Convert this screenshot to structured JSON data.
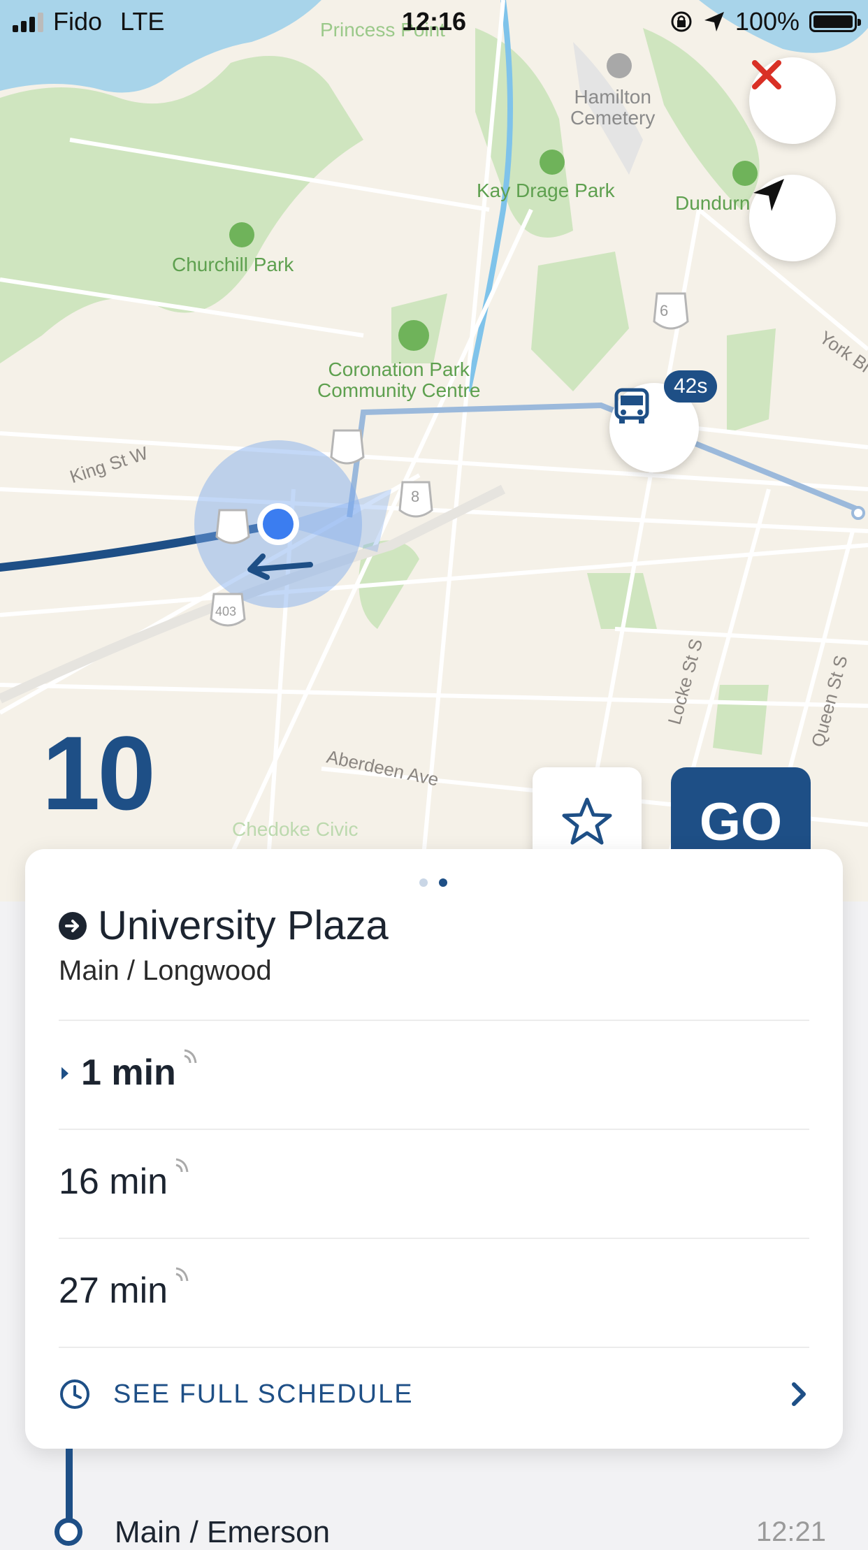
{
  "status_bar": {
    "carrier": "Fido",
    "network": "LTE",
    "time": "12:16",
    "battery": "100%"
  },
  "map": {
    "labels": {
      "princess_point": "Princess Point",
      "hamilton_cemetery": "Hamilton\nCemetery",
      "kay_drage_park": "Kay Drage Park",
      "dundurn": "Dundurn",
      "churchill_park": "Churchill Park",
      "coronation_park": "Coronation Park\nCommunity Centre",
      "king_st_w": "King St W",
      "york_blvd": "York Bl",
      "locke_st_s": "Locke St S",
      "queen_st_s": "Queen St S",
      "aberdeen_ave": "Aberdeen Ave",
      "chedoke_civic": "Chedoke Civic"
    },
    "shields": [
      "6",
      "8",
      "403"
    ],
    "bus_eta": "42s"
  },
  "route": {
    "number": "10",
    "go_label": "GO"
  },
  "card": {
    "destination": "University Plaza",
    "stop": "Main / Longwood",
    "departures": [
      "1 min",
      "16 min",
      "27 min"
    ],
    "schedule_label": "SEE FULL SCHEDULE"
  },
  "next_stop": {
    "name": "Main / Emerson",
    "time": "12:21"
  },
  "colors": {
    "brand": "#1e4f86",
    "close": "#d93025",
    "park": "#cfe5bf",
    "water": "#a8d4ea"
  }
}
